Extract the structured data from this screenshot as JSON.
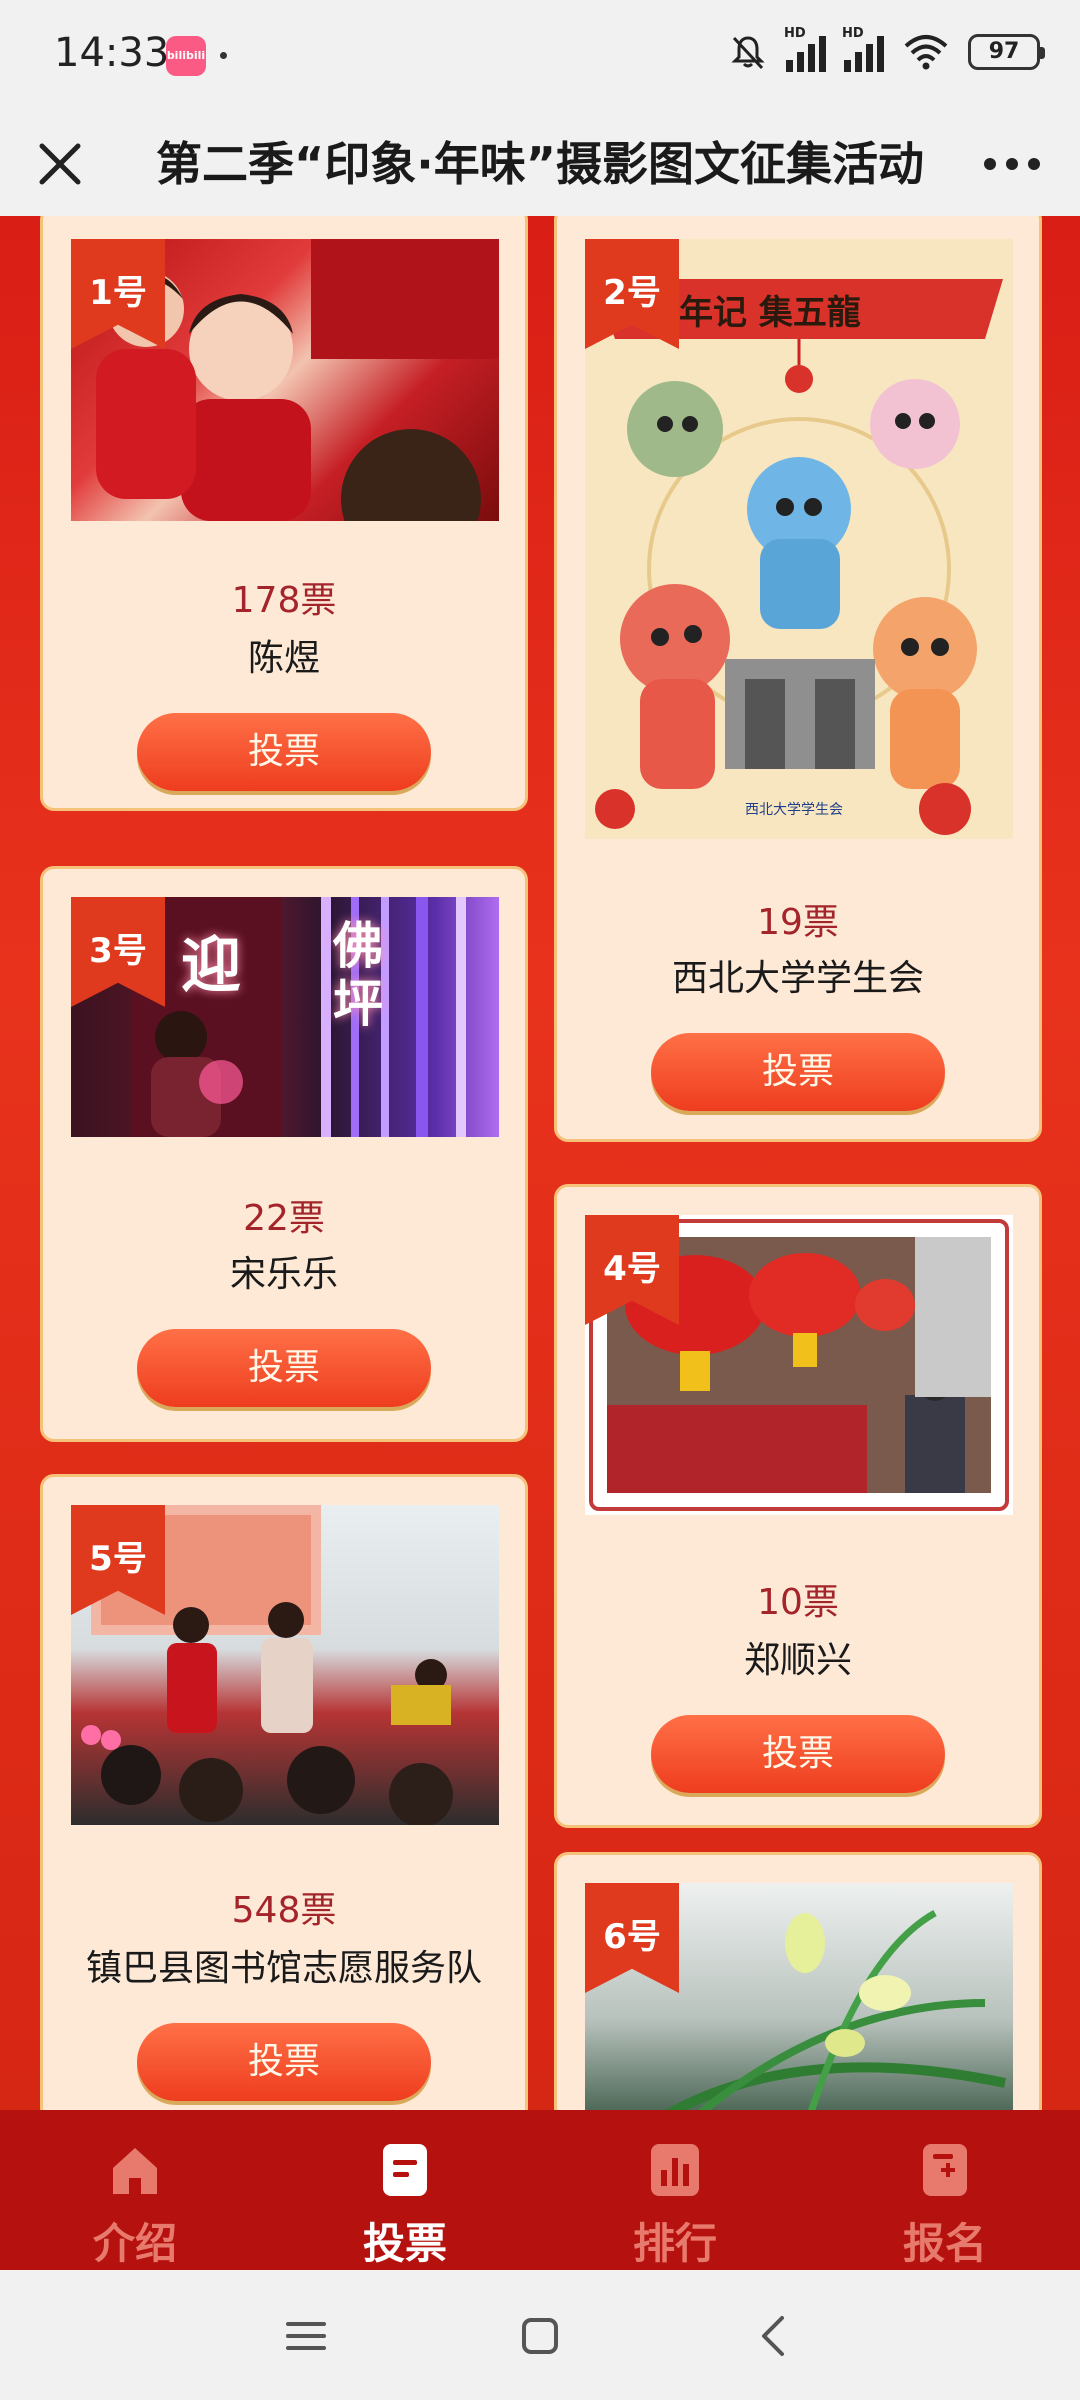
{
  "status_bar": {
    "time": "14:33",
    "app_icon_label": "bilibili",
    "network_1": "HD",
    "network_2": "HD",
    "battery": "97"
  },
  "header": {
    "title": "第二季“印象·年味”摄影图文征集活动"
  },
  "entries": [
    {
      "badge": "1号",
      "votes": "178票",
      "name": "陈煜",
      "button": "投票"
    },
    {
      "badge": "2号",
      "votes": "19票",
      "name": "西北大学学生会",
      "button": "投票",
      "poster_text": "寻年记 集五龍",
      "logo_text": "西北大学学生会"
    },
    {
      "badge": "3号",
      "votes": "22票",
      "name": "宋乐乐",
      "button": "投票",
      "photo_text_1": "迎",
      "photo_text_2": "佛坪"
    },
    {
      "badge": "4号",
      "votes": "10票",
      "name": "郑顺兴",
      "button": "投票"
    },
    {
      "badge": "5号",
      "votes": "548票",
      "name": "镇巴县图书馆志愿服务队",
      "button": "投票"
    },
    {
      "badge": "6号"
    }
  ],
  "tabs": [
    {
      "label": "介绍",
      "icon": "home-icon",
      "active": false
    },
    {
      "label": "投票",
      "icon": "vote-icon",
      "active": true
    },
    {
      "label": "排行",
      "icon": "chart-icon",
      "active": false
    },
    {
      "label": "报名",
      "icon": "signup-icon",
      "active": false
    }
  ],
  "colors": {
    "background_red": "#e0281a",
    "card_bg": "#fde9d6",
    "button": "#f04a24",
    "votes_text": "#a3242a",
    "tabbar": "#b5120f"
  }
}
